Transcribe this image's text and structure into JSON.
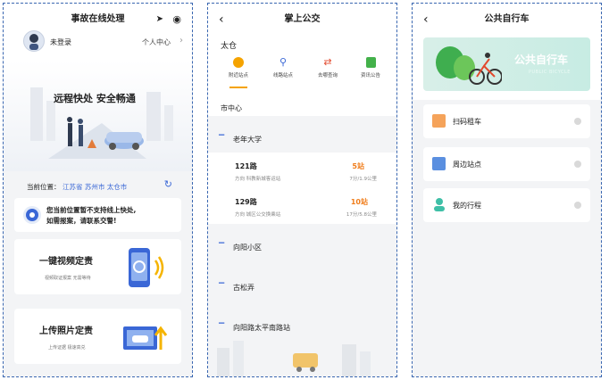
{
  "panel1": {
    "title": "事故在线处理",
    "user_label": "未登录",
    "personal_center": "个人中心",
    "hero_text": "远程快处 安全畅通",
    "location_prefix": "当前位置：",
    "location_value": "江苏省 苏州市 太仓市",
    "notice": "您当前位置暂不支持线上快处,\n如需报案，请联系交警!",
    "video_card": {
      "title": "一键视频定责",
      "sub": "视频取证报案 无需等待"
    },
    "photo_card": {
      "title": "上传照片定责",
      "sub": "上传证据 极速高兑"
    }
  },
  "panel2": {
    "title": "掌上公交",
    "city": "太仓",
    "tabs": [
      "附近站点",
      "线路站点",
      "去哪查询",
      "资讯公告"
    ],
    "section": "市中心",
    "stops": [
      {
        "name": "老年大学"
      },
      {
        "name": "向阳小区"
      },
      {
        "name": "古松弄"
      },
      {
        "name": "向阳路太平南路站"
      }
    ],
    "routes": [
      {
        "name": "121路",
        "direction": "方向 科教新城客运站",
        "stations": "5站",
        "detail": "7分/1.9公里"
      },
      {
        "name": "129路",
        "direction": "方向 城区公交换乘站",
        "stations": "10站",
        "detail": "17分/5.8公里"
      }
    ]
  },
  "panel3": {
    "title": "公共自行车",
    "banner_title": "公共自行车",
    "banner_sub": "PUBLIC BICYCLE",
    "items": [
      "扫码租车",
      "周边站点",
      "我的行程"
    ]
  },
  "colors": {
    "accent": "#3a67d6",
    "orange": "#f07d1b",
    "teal": "#3fbfa7"
  }
}
